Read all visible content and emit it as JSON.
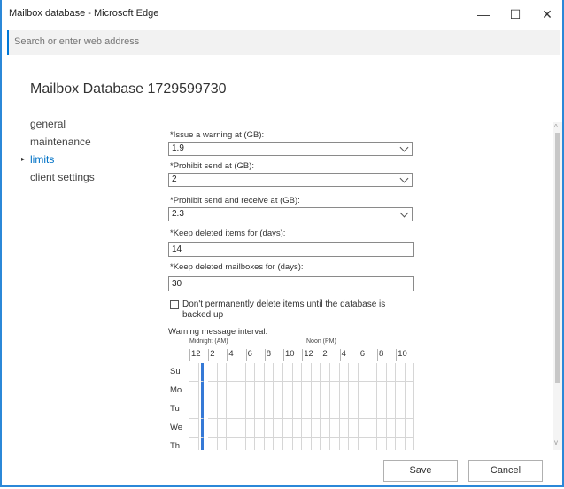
{
  "window": {
    "title": "Mailbox database - Microsoft Edge",
    "minimize": "—",
    "maximize": "☐",
    "close": "✕"
  },
  "address_bar": {
    "placeholder": "Search or enter web address"
  },
  "page": {
    "title": "Mailbox Database 1729599730"
  },
  "nav": {
    "items": [
      {
        "label": "general"
      },
      {
        "label": "maintenance"
      },
      {
        "label": "limits"
      },
      {
        "label": "client settings"
      }
    ],
    "active_index": 2,
    "active_marker": "▸"
  },
  "form": {
    "issue_warning": {
      "label": "*Issue a warning at (GB):",
      "value": "1.9"
    },
    "prohibit_send": {
      "label": "*Prohibit send at (GB):",
      "value": "2"
    },
    "prohibit_send_receive": {
      "label": "*Prohibit send and receive at (GB):",
      "value": "2.3"
    },
    "keep_deleted_items": {
      "label": "*Keep deleted items for (days):",
      "value": "14"
    },
    "keep_deleted_mailboxes": {
      "label": "*Keep deleted mailboxes for (days):",
      "value": "30"
    },
    "dont_delete_checkbox": {
      "label": "Don't permanently delete items until the database is backed up",
      "checked": false
    },
    "warning_interval": {
      "label": "Warning message interval:",
      "midnight_label": "Midnight (AM)",
      "noon_label": "Noon (PM)",
      "hours": [
        "12",
        "2",
        "4",
        "6",
        "8",
        "10",
        "12",
        "2",
        "4",
        "6",
        "8",
        "10"
      ],
      "days": [
        "Su",
        "Mo",
        "Tu",
        "We",
        "Th"
      ],
      "selected_column": 1
    }
  },
  "buttons": {
    "save": "Save",
    "cancel": "Cancel"
  },
  "colors": {
    "accent": "#0072c6",
    "selection": "#3579d6",
    "window_border": "#2b88d8"
  }
}
